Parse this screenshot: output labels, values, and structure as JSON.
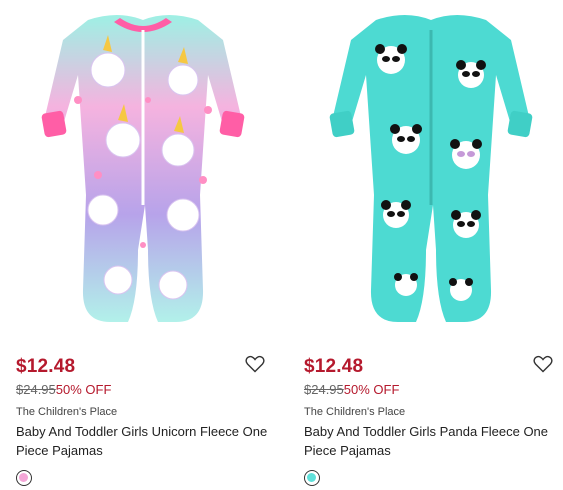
{
  "products": [
    {
      "image_icon": "unicorn-fleece-pajama-image",
      "sale_price": "$12.48",
      "original_price": "$24.95",
      "discount": "50% OFF",
      "brand": "The Children's Place",
      "name": "Baby And Toddler Girls Unicorn Fleece One Piece Pajamas",
      "swatch_color": "#f4a6d7",
      "base_color": "#b9a4e6",
      "accent_color": "#ff4f9a"
    },
    {
      "image_icon": "panda-fleece-pajama-image",
      "sale_price": "$12.48",
      "original_price": "$24.95",
      "discount": "50% OFF",
      "brand": "The Children's Place",
      "name": "Baby And Toddler Girls Panda Fleece One Piece Pajamas",
      "swatch_color": "#5fe0da",
      "base_color": "#4ddad2",
      "accent_color": "#111111"
    }
  ],
  "colors": {
    "sale_red": "#b5192d",
    "text_dark": "#222222",
    "text_muted": "#666666"
  }
}
